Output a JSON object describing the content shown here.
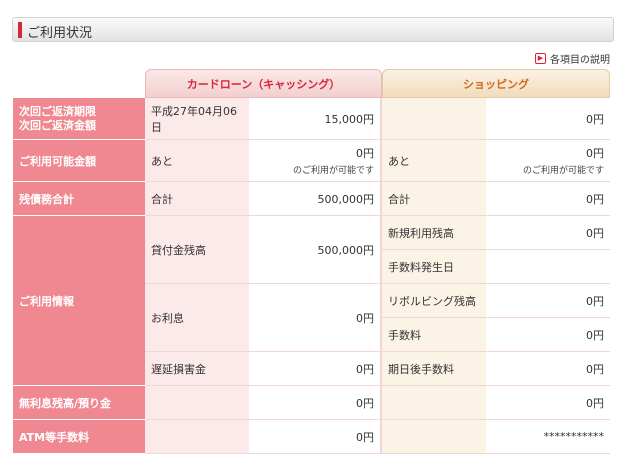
{
  "page": {
    "title": "ご利用状況",
    "help_link": "各項目の説明"
  },
  "tabs": {
    "card_loan": "カードローン（キャッシング）",
    "shopping": "ショッピング"
  },
  "rows": {
    "repayment": {
      "head1": "次回ご返済期限",
      "head2": "次回ご返済金額",
      "card_label": "平成27年04月06日",
      "card_value": "15,000円",
      "shop_label": "",
      "shop_value": "0円"
    },
    "available": {
      "head": "ご利用可能金額",
      "card_label": "あと",
      "card_value": "0円",
      "card_sub": "のご利用が可能です",
      "shop_label": "あと",
      "shop_value": "0円",
      "shop_sub": "のご利用が可能です"
    },
    "balance": {
      "head": "残債務合計",
      "card_label": "合計",
      "card_value": "500,000円",
      "shop_label": "合計",
      "shop_value": "0円"
    },
    "info": {
      "head": "ご利用情報",
      "card_principal_label": "貸付金残高",
      "card_principal_value": "500,000円",
      "card_interest_label": "お利息",
      "card_interest_value": "0円",
      "card_late_label": "遅延損害金",
      "card_late_value": "0円",
      "shop_new_label": "新規利用残高",
      "shop_new_value": "0円",
      "shop_fee_occur_label": "手数料発生日",
      "shop_fee_occur_value": "",
      "shop_revolving_label": "リボルビング残高",
      "shop_revolving_value": "0円",
      "shop_fee_label": "手数料",
      "shop_fee_value": "0円",
      "shop_after_fee_label": "期日後手数料",
      "shop_after_fee_value": "0円"
    },
    "deposit": {
      "head": "無利息残高/預り金",
      "card_value": "0円",
      "shop_value": "0円"
    },
    "atm": {
      "head": "ATM等手数料",
      "card_value": "0円",
      "shop_value": "***********"
    }
  }
}
